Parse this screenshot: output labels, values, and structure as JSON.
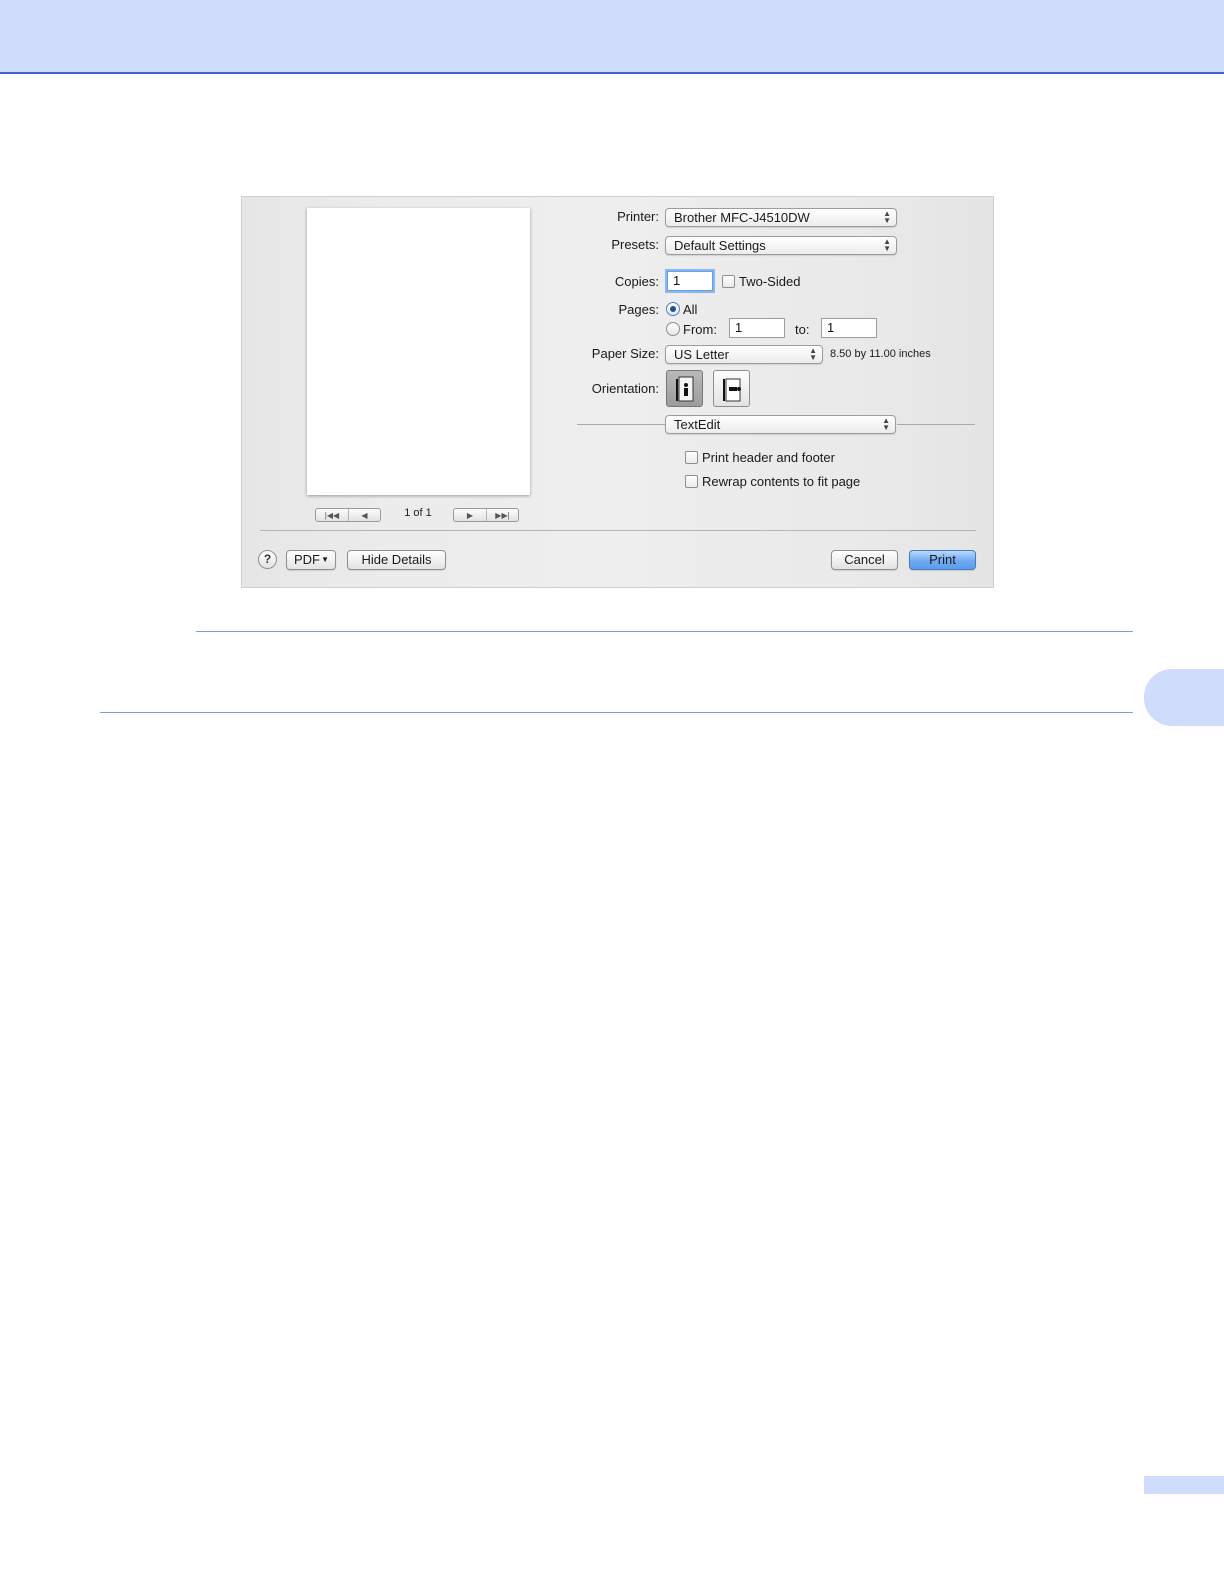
{
  "dialog": {
    "printer": {
      "label": "Printer:",
      "value": "Brother MFC-J4510DW"
    },
    "presets": {
      "label": "Presets:",
      "value": "Default Settings"
    },
    "copies": {
      "label": "Copies:",
      "value": "1",
      "two_sided_label": "Two-Sided"
    },
    "pages": {
      "label": "Pages:",
      "all_label": "All",
      "from_label": "From:",
      "from_value": "1",
      "to_label": "to:",
      "to_value": "1"
    },
    "paper_size": {
      "label": "Paper Size:",
      "value": "US Letter",
      "dimensions": "8.50 by 11.00 inches"
    },
    "orientation": {
      "label": "Orientation:"
    },
    "section_popup": {
      "value": "TextEdit"
    },
    "options": {
      "print_header_footer": "Print header and footer",
      "rewrap_contents": "Rewrap contents to fit page"
    },
    "preview": {
      "page_count": "1 of 1"
    },
    "footer": {
      "help": "?",
      "pdf": "PDF",
      "hide_details": "Hide Details",
      "cancel": "Cancel",
      "print": "Print"
    }
  }
}
